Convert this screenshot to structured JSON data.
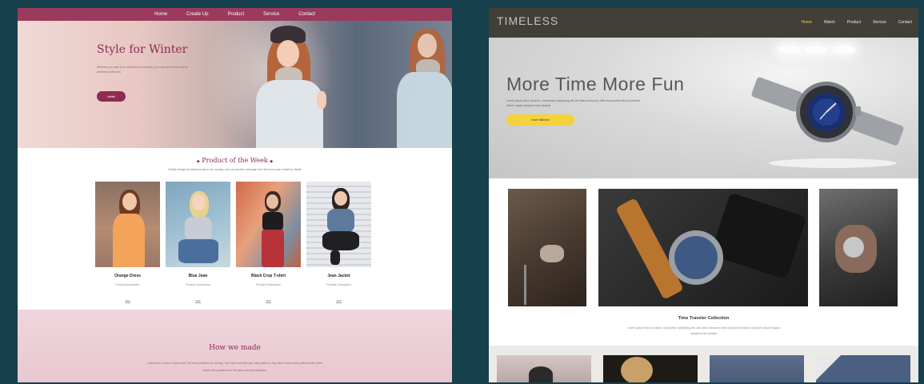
{
  "fashion_site": {
    "nav": [
      "Home",
      "Create Up",
      "Product",
      "Service",
      "Contact"
    ],
    "hero": {
      "title": "Style for Winter",
      "line1": "Whether you want your wardrobe for evening, your casual is fresh look for",
      "line2": "weekend a lift story",
      "button": "detail"
    },
    "section_title": "Product of the Week",
    "section_subtitle": "InStyle brings the latest trends to the runway, and our favorite coverage from the front rows of fashion Week",
    "products": [
      {
        "name": "Orange Dress",
        "desc": "Product description",
        "price": "view"
      },
      {
        "name": "Blue Jean",
        "desc": "Product Description",
        "price": "view"
      },
      {
        "name": "Black Crop T-shirt",
        "desc": "Product Description",
        "price": "view"
      },
      {
        "name": "Jean Jacket",
        "desc": "Product Description",
        "price": "view"
      }
    ],
    "bottom": {
      "title": "How we made",
      "line1": "Learn How to sew a dress with The clean patterns for sewing. You'll find how little get retail patterns, that offers cross-wear patterns with other",
      "line2": "simple dress patterns in the styles sewing collection."
    }
  },
  "watch_site": {
    "logo": "TIMELESS",
    "nav": [
      "Home",
      "Watch",
      "Product",
      "Service",
      "Contact"
    ],
    "active_nav": "Home",
    "hero": {
      "title": "More Time More Fun",
      "line1": "Lorem ipsum dolor sit amet, consectetur adipiscing elit sed diam nonummy nibh euismod tincidunt ut laoreet",
      "line2": "dolore magna aliquam erat volutpat",
      "button": "more Watches"
    },
    "collection": {
      "title": "Time Traveler Collection",
      "line1": "Lorem ipsum dolor sit amet, consectetur adipiscing elit, sed diam nonummy nibh euismod tincidunt ut laoreet dolore magna",
      "line2": "aliquam erat volutpat"
    }
  },
  "colors": {
    "backdrop": "#16404c",
    "fashion_accent": "#8e2b52",
    "fashion_nav": "#9b3a5c",
    "watch_nav": "#423f39",
    "watch_accent": "#f3d23c"
  }
}
